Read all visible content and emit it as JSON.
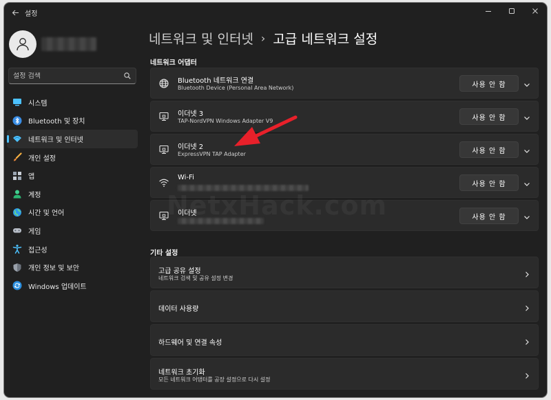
{
  "window": {
    "title": "설정"
  },
  "sidebar": {
    "search_placeholder": "설정 검색",
    "items": [
      {
        "label": "시스템",
        "icon": "system-icon",
        "active": false
      },
      {
        "label": "Bluetooth 및 장치",
        "icon": "bluetooth-icon",
        "active": false
      },
      {
        "label": "네트워크 및 인터넷",
        "icon": "network-icon",
        "active": true
      },
      {
        "label": "개인 설정",
        "icon": "brush-icon",
        "active": false
      },
      {
        "label": "앱",
        "icon": "apps-icon",
        "active": false
      },
      {
        "label": "계정",
        "icon": "account-icon",
        "active": false
      },
      {
        "label": "시간 및 언어",
        "icon": "globe-icon",
        "active": false
      },
      {
        "label": "게임",
        "icon": "gamepad-icon",
        "active": false
      },
      {
        "label": "접근성",
        "icon": "accessibility-icon",
        "active": false
      },
      {
        "label": "개인 정보 및 보안",
        "icon": "shield-icon",
        "active": false
      },
      {
        "label": "Windows 업데이트",
        "icon": "update-icon",
        "active": false
      }
    ]
  },
  "breadcrumb": {
    "parent": "네트워크 및 인터넷",
    "separator": "›",
    "current": "고급 네트워크 설정"
  },
  "adapters": {
    "heading": "네트워크 어댑터",
    "button_label": "사용 안 함",
    "items": [
      {
        "name": "Bluetooth 네트워크 연결",
        "detail": "Bluetooth Device (Personal Area Network)",
        "icon": "globe-network-icon"
      },
      {
        "name": "이더넷 3",
        "detail": "TAP-NordVPN Windows Adapter V9",
        "icon": "ethernet-icon"
      },
      {
        "name": "이더넷 2",
        "detail": "ExpressVPN TAP Adapter",
        "icon": "ethernet-icon"
      },
      {
        "name": "Wi-Fi",
        "detail": "",
        "icon": "wifi-icon"
      },
      {
        "name": "이더넷",
        "detail": "",
        "icon": "ethernet-icon"
      }
    ]
  },
  "other": {
    "heading": "기타 설정",
    "items": [
      {
        "title": "고급 공유 설정",
        "subtitle": "네트워크 검색 및 공유 설정 변경"
      },
      {
        "title": "데이터 사용량",
        "subtitle": ""
      },
      {
        "title": "하드웨어 및 연결 속성",
        "subtitle": ""
      },
      {
        "title": "네트워크 초기화",
        "subtitle": "모든 네트워크 어댑터를 공장 설정으로 다시 설정"
      }
    ]
  },
  "watermark": "NetxHack.com",
  "colors": {
    "accent": "#4cc2ff",
    "annotation_arrow": "#e8202a"
  }
}
